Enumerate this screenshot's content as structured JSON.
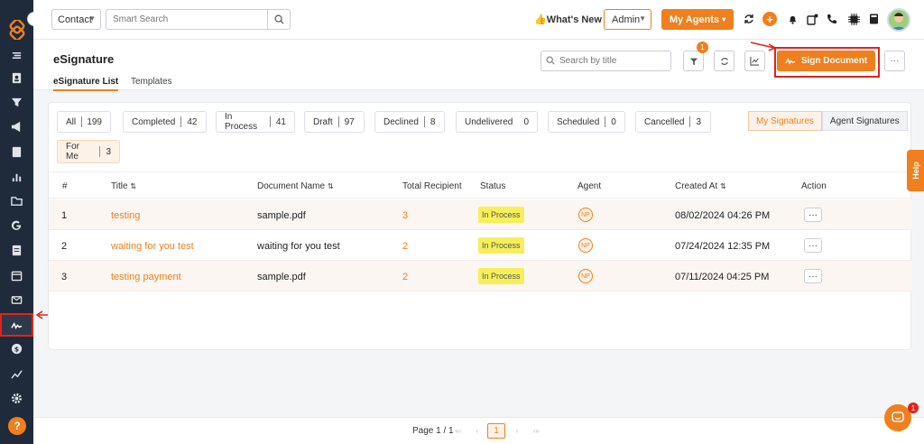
{
  "topbar": {
    "context_select": "Contact",
    "search_placeholder": "Smart Search",
    "whats_new": "👍What's New",
    "admin_select": "Admin",
    "my_agents": "My Agents"
  },
  "header": {
    "title": "eSignature",
    "tabs": [
      {
        "label": "eSignature List",
        "active": true
      },
      {
        "label": "Templates",
        "active": false
      }
    ],
    "search_placeholder": "Search by title",
    "filter_badge": "1",
    "sign_document": "Sign Document"
  },
  "filters": [
    {
      "label": "All",
      "count": "199"
    },
    {
      "label": "Completed",
      "count": "42"
    },
    {
      "label": "In Process",
      "count": "41"
    },
    {
      "label": "Draft",
      "count": "97"
    },
    {
      "label": "Declined",
      "count": "8"
    },
    {
      "label": "Undelivered",
      "count": "0"
    },
    {
      "label": "Scheduled",
      "count": "0"
    },
    {
      "label": "Cancelled",
      "count": "3"
    },
    {
      "label": "For Me",
      "count": "3"
    }
  ],
  "signature_toggle": {
    "mine": "My Signatures",
    "agent": "Agent Signatures"
  },
  "table": {
    "columns": [
      "#",
      "Title",
      "Document Name",
      "Total Recipient",
      "Status",
      "Agent",
      "Created At",
      "Action"
    ],
    "rows": [
      {
        "num": "1",
        "title": "testing",
        "document": "sample.pdf",
        "recipients": "3",
        "status": "In Process",
        "agent": "NP",
        "created": "08/02/2024 04:26 PM",
        "action": "···"
      },
      {
        "num": "2",
        "title": "waiting for you test",
        "document": "waiting for you test",
        "recipients": "2",
        "status": "In Process",
        "agent": "NP",
        "created": "07/24/2024 12:35 PM",
        "action": "···"
      },
      {
        "num": "3",
        "title": "testing payment",
        "document": "sample.pdf",
        "recipients": "2",
        "status": "In Process",
        "agent": "NP",
        "created": "07/11/2024 04:25 PM",
        "action": "···"
      }
    ]
  },
  "pagination": {
    "text": "Page 1 / 1",
    "current": "1",
    "first": "«‹",
    "prev": "‹",
    "next": "›",
    "last": "›»"
  },
  "help_tab": "Help",
  "chat_badge": "1",
  "sidebar_help": "?",
  "colors": {
    "accent": "#f07f1d",
    "sidebar": "#1f2b3a",
    "highlight": "#e2231a",
    "status_bg": "#f7ef5a"
  },
  "icons": [
    "list-icon",
    "contact-card-icon",
    "funnel-icon",
    "megaphone-icon",
    "book-icon",
    "bar-chart-icon",
    "folder-icon",
    "google-icon",
    "document-icon",
    "calendar-icon",
    "mail-icon",
    "signature-icon",
    "dollar-icon",
    "trend-icon",
    "gear-icon"
  ]
}
